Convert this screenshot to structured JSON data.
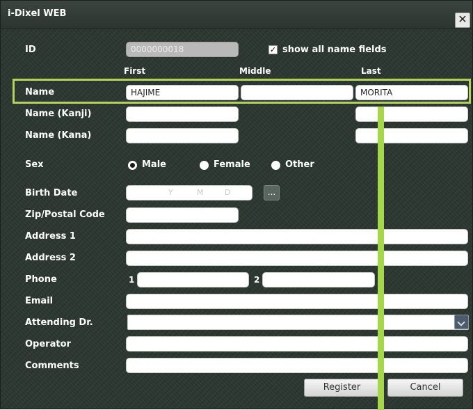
{
  "window": {
    "title": "i-Dixel WEB",
    "close_glyph": "✕"
  },
  "id_row": {
    "label": "ID",
    "value": "0000000018"
  },
  "show_all": {
    "label": "show all name fields",
    "checked": true,
    "check_glyph": "✓"
  },
  "columns": {
    "first": "First",
    "middle": "Middle",
    "last": "Last"
  },
  "name": {
    "label": "Name",
    "first": "HAJIME",
    "middle": "",
    "last": "MORITA"
  },
  "name_kanji": {
    "label": "Name (Kanji)",
    "first": "",
    "last": ""
  },
  "name_kana": {
    "label": "Name (Kana)",
    "first": "",
    "last": ""
  },
  "sex": {
    "label": "Sex",
    "options": [
      {
        "label": "Male",
        "checked": true
      },
      {
        "label": "Female",
        "checked": false
      },
      {
        "label": "Other",
        "checked": false
      }
    ]
  },
  "birth_date": {
    "label": "Birth Date",
    "y": "Y",
    "m": "M",
    "d": "D",
    "picker_label": "..."
  },
  "zip": {
    "label": "Zip/Postal Code",
    "value": ""
  },
  "address1": {
    "label": "Address 1",
    "value": ""
  },
  "address2": {
    "label": "Address 2",
    "value": ""
  },
  "phone": {
    "label": "Phone",
    "n1": "1",
    "n2": "2",
    "value1": "",
    "value2": ""
  },
  "email": {
    "label": "Email",
    "value": ""
  },
  "attending": {
    "label": "Attending Dr.",
    "value": ""
  },
  "operator": {
    "label": "Operator",
    "value": ""
  },
  "comments": {
    "label": "Comments",
    "value": ""
  },
  "buttons": {
    "register": "Register",
    "cancel": "Cancel"
  },
  "colors": {
    "highlight": "#b3d35a",
    "guide_bar": "#a5d64b",
    "background": "#2b3630"
  }
}
